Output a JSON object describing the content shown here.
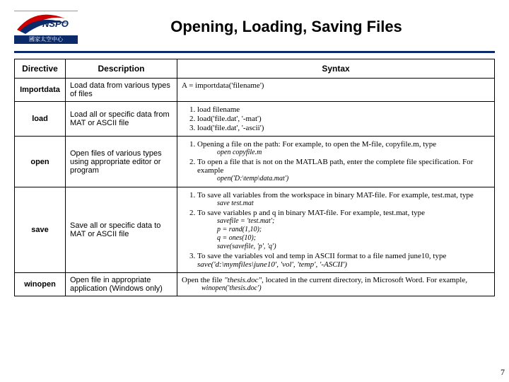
{
  "header": {
    "logo_text_top": "NSPO",
    "logo_text_bottom": "國家太空中心",
    "title": "Opening, Loading, Saving Files"
  },
  "table": {
    "headers": {
      "c1": "Directive",
      "c2": "Description",
      "c3": "Syntax"
    },
    "rows": {
      "importdata": {
        "directive": "Importdata",
        "desc": "Load data from various types of files",
        "syntax": "A = importdata('filename')"
      },
      "load": {
        "directive": "load",
        "desc": "Load all or specific data from MAT or ASCII file",
        "items": [
          "load filename",
          "load('file.dat', '-mat')",
          "load('file.dat', '-ascii')"
        ]
      },
      "open": {
        "directive": "open",
        "desc": "Open files of various types using appropriate editor or program",
        "item1_text": "Opening a file on the path: For example, to open the M-file, copyfile.m, type",
        "item1_example": "open copyfile.m",
        "item2_text": "To open a file that is not on the MATLAB path, enter the complete file specification. For example",
        "item2_example": "open('D:\\temp\\data.mat')"
      },
      "save": {
        "directive": "save",
        "desc": "Save all or specific data to MAT or ASCII file",
        "item1_text": "To save all variables from the workspace in binary MAT-file. For example, test.mat, type",
        "item1_example": "save test.mat",
        "item2_text": "To save variables p and q in binary MAT-file. For example, test.mat, type",
        "item2_example_lines": [
          "savefile = 'test.mat';",
          "p = rand(1,10);",
          "q = ones(10);",
          "save(savefile, 'p', 'q')"
        ],
        "item3_text": "To save the variables vol and temp in ASCII format to a file named june10, type ",
        "item3_code": "save('d:\\mymfiles\\june10', 'vol', 'temp', '-ASCII')"
      },
      "winopen": {
        "directive": "winopen",
        "desc": "Open file in appropriate application (Windows only)",
        "text_a": "Open the file ",
        "text_quoted": "\"thesis.doc\"",
        "text_b": ", located in the current directory, in Microsoft Word. For example,",
        "example": "winopen('thesis.doc')"
      }
    }
  },
  "page_number": "7"
}
